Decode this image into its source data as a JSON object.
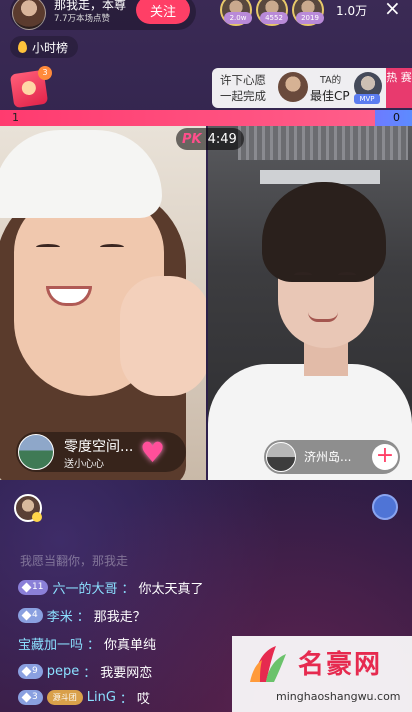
{
  "header": {
    "host_name": "那我走，本尊",
    "host_likes": "7.7万本场点赞",
    "follow_label": "关注",
    "viewers": [
      {
        "badge": "2.0w"
      },
      {
        "badge": "4552"
      },
      {
        "badge": "2019"
      }
    ],
    "viewer_count": "1.0万",
    "close_icon": "×"
  },
  "hour_rank": {
    "label": "小时榜"
  },
  "redbag": {
    "count": "3"
  },
  "wish": {
    "text": "许下心愿 一起完成",
    "cp_small": "TA的",
    "cp_label": "最佳CP",
    "mvp": "MVP",
    "hot_tag": "热 赛"
  },
  "pk": {
    "score_left": "1",
    "score_right": "0",
    "left_share": 0.91,
    "logo": "PK",
    "time": "4:49"
  },
  "anchor_left": {
    "name": "零度空间...",
    "sub": "送小心心",
    "heart_icon": "♥"
  },
  "anchor_right": {
    "name": "济州岛...",
    "plus": "+"
  },
  "chat": {
    "faded": "我愿当翻你，那我走",
    "messages": [
      {
        "level": "11",
        "level_color": "#8b80d8",
        "user": "六一的大哥",
        "sep": "：",
        "text": "你太天真了"
      },
      {
        "level": "4",
        "level_color": "#8aa0e0",
        "user": "李米",
        "sep": "：",
        "text": "那我走？"
      },
      {
        "level": "",
        "level_color": "",
        "user": "宝藏加一吗",
        "sep": "：",
        "text": "你真单纯"
      },
      {
        "level": "9",
        "level_color": "#8aa0e0",
        "user": "pepe",
        "sep": "：",
        "text": "我要网恋"
      },
      {
        "level": "3",
        "level_color": "#8aa0e0",
        "fan": "源斗团",
        "user": "LinG",
        "sep": "：",
        "text": "哎"
      }
    ]
  },
  "watermark": {
    "title": "名豪网",
    "url": "minghaoshangwu.com"
  }
}
